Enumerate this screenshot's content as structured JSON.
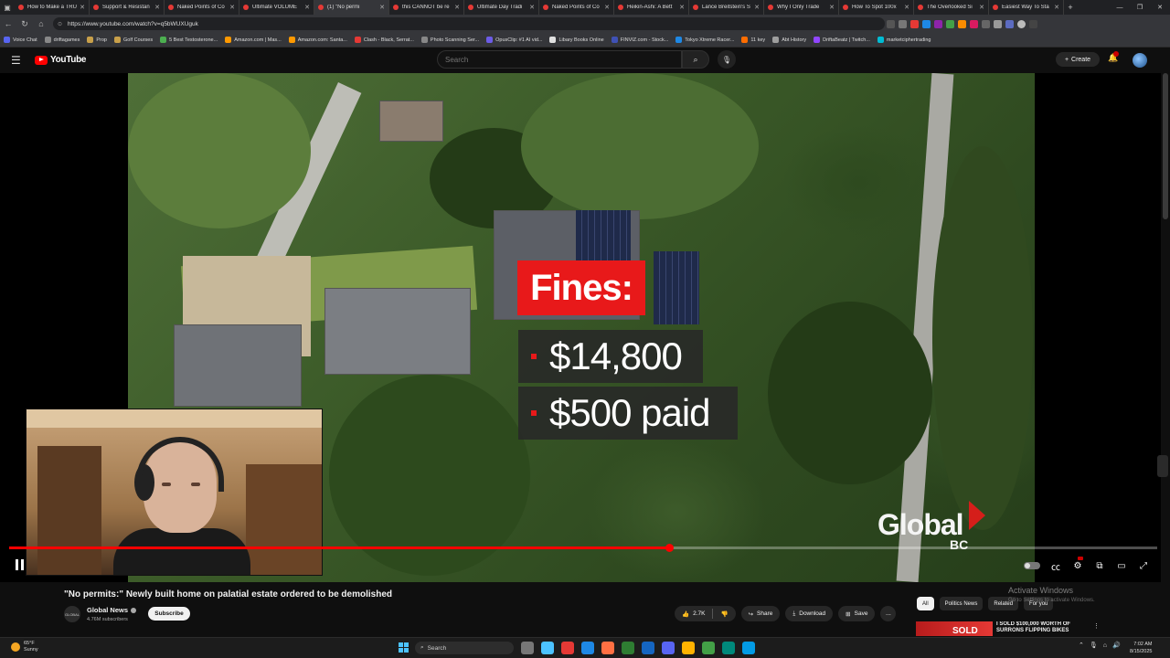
{
  "browser": {
    "tabs": [
      {
        "label": "How to Make a TRU",
        "active": false
      },
      {
        "label": "Support & Resistan",
        "active": false
      },
      {
        "label": "Naked Points of Co",
        "active": false
      },
      {
        "label": "Ultimate VOLUME",
        "active": false
      },
      {
        "label": "(1) \"No permi",
        "active": true
      },
      {
        "label": "this CANNOT be re",
        "active": false
      },
      {
        "label": "Ultimate Day Tradi",
        "active": false
      },
      {
        "label": "Naked Points of Co",
        "active": false
      },
      {
        "label": "Heikin-Ashi: A Bett",
        "active": false
      },
      {
        "label": "Lance Breitstein's S",
        "active": false
      },
      {
        "label": "Why I Only Trade",
        "active": false
      },
      {
        "label": "How To Spot 100x",
        "active": false
      },
      {
        "label": "The Overlooked Si",
        "active": false
      },
      {
        "label": "Easiest Way To Sta",
        "active": false
      }
    ],
    "url": "https://www.youtube.com/watch?v=q5bWUXUguk",
    "bookmarks": [
      {
        "label": "Voice Chat",
        "color": "#5865f2"
      },
      {
        "label": "driftagames",
        "color": "#888888"
      },
      {
        "label": "Prop",
        "color": "#c8a04a"
      },
      {
        "label": "Golf Courses",
        "color": "#c8a04a"
      },
      {
        "label": "5 Best Testosterone...",
        "color": "#4caf50"
      },
      {
        "label": "Amazon.com | Mas...",
        "color": "#ff9900"
      },
      {
        "label": "Amazon.com: Santa...",
        "color": "#ff9900"
      },
      {
        "label": "Clash - Black, Serrat...",
        "color": "#e53935"
      },
      {
        "label": "Photo Scanning Ser...",
        "color": "#888888"
      },
      {
        "label": "OpusClip: #1 AI vid...",
        "color": "#6c5ce7"
      },
      {
        "label": "Libary Books Online",
        "color": "#e0e0e0"
      },
      {
        "label": "FINVIZ.com - Stock...",
        "color": "#3f51b5"
      },
      {
        "label": "Tokyo Xtreme Racer...",
        "color": "#1e88e5"
      },
      {
        "label": "11 key",
        "color": "#ff6d00"
      },
      {
        "label": "Abt History",
        "color": "#9e9e9e"
      },
      {
        "label": "DriftaBeatz | Twitch...",
        "color": "#9146ff"
      },
      {
        "label": "marketciphertrading",
        "color": "#00bcd4"
      }
    ]
  },
  "youtube": {
    "brand": "YouTube",
    "search_placeholder": "Search",
    "create_label": "Create"
  },
  "video": {
    "overlay_heading": "Fines:",
    "fines": [
      "$14,800",
      "$500 paid"
    ],
    "network_logo": "Global",
    "network_region": "BC",
    "progress_fraction": 0.575,
    "title": "\"No permits:\" Newly built home on palatial estate ordered to be demolished",
    "channel": {
      "name": "Global News",
      "avatar_text": "GLOBAL",
      "subscribers": "4.76M subscribers",
      "subscribe_label": "Subscribe"
    },
    "actions": {
      "likes": "2.7K",
      "share": "Share",
      "download": "Download",
      "save": "Save",
      "more": "..."
    }
  },
  "related": {
    "chips": [
      {
        "label": "All",
        "active": true
      },
      {
        "label": "Politics News",
        "active": false
      },
      {
        "label": "Related",
        "active": false
      },
      {
        "label": "For you",
        "active": false
      }
    ],
    "first_item": {
      "thumb_text": "SOLD",
      "title": "I SOLD $100,000 WORTH OF SURRONS FLIPPING BIKES"
    }
  },
  "watermark": {
    "title": "Activate Windows",
    "subtitle": "Go to Settings to activate Windows."
  },
  "taskbar": {
    "weather_temp": "65°F",
    "weather_desc": "Sunny",
    "search_label": "Search",
    "time": "7:02 AM",
    "date": "8/15/2025"
  }
}
